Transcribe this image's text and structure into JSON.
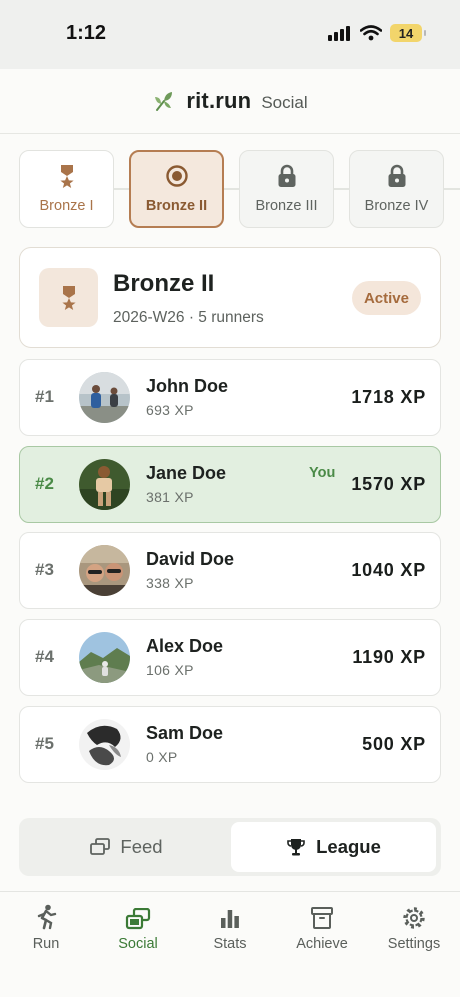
{
  "status_bar": {
    "time": "1:12",
    "battery": "14"
  },
  "header": {
    "brand": "rit.run",
    "section": "Social",
    "logo_icon": "leaf-icon"
  },
  "tiers": [
    {
      "label": "Bronze I",
      "state": "earned",
      "icon": "medal-icon"
    },
    {
      "label": "Bronze II",
      "state": "current",
      "icon": "target-icon"
    },
    {
      "label": "Bronze III",
      "state": "locked",
      "icon": "lock-icon"
    },
    {
      "label": "Bronze IV",
      "state": "locked",
      "icon": "lock-icon"
    }
  ],
  "league": {
    "title": "Bronze II",
    "meta": "2026-W26 · 5 runners",
    "status": "Active",
    "icon": "medal-icon"
  },
  "leaderboard": [
    {
      "rank": "#1",
      "name": "John Doe",
      "sub": "693 XP",
      "xp": "1718 XP",
      "is_me": false,
      "you_label": ""
    },
    {
      "rank": "#2",
      "name": "Jane Doe",
      "sub": "381 XP",
      "xp": "1570 XP",
      "is_me": true,
      "you_label": "You"
    },
    {
      "rank": "#3",
      "name": "David Doe",
      "sub": "338 XP",
      "xp": "1040 XP",
      "is_me": false,
      "you_label": ""
    },
    {
      "rank": "#4",
      "name": "Alex Doe",
      "sub": "106 XP",
      "xp": "1190 XP",
      "is_me": false,
      "you_label": ""
    },
    {
      "rank": "#5",
      "name": "Sam Doe",
      "sub": "0 XP",
      "xp": "500 XP",
      "is_me": false,
      "you_label": ""
    }
  ],
  "segment": {
    "feed_label": "Feed",
    "league_label": "League",
    "selected": "League"
  },
  "tabbar": [
    {
      "label": "Run",
      "icon": "runner-icon"
    },
    {
      "label": "Social",
      "icon": "social-icon",
      "active": true
    },
    {
      "label": "Stats",
      "icon": "bar-chart-icon"
    },
    {
      "label": "Achieve",
      "icon": "archive-icon"
    },
    {
      "label": "Settings",
      "icon": "gear-icon"
    }
  ],
  "colors": {
    "accent_green": "#3b7a36",
    "bronze": "#a9744a",
    "me_highlight": "#e2efe0"
  }
}
